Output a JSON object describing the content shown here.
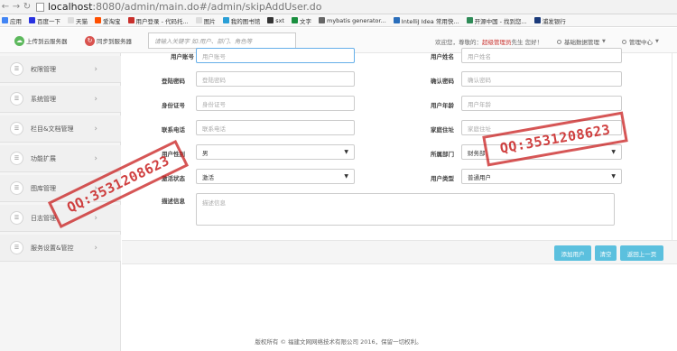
{
  "browser": {
    "url_host": "localhost",
    "url_path": ":8080/admin/main.do#/admin/skipAddUser.do",
    "bookmarks": [
      {
        "label": "应用",
        "color": "#4285f4"
      },
      {
        "label": "百度一下",
        "color": "#2932e1"
      },
      {
        "label": "天猫",
        "color": "#dddddd"
      },
      {
        "label": "爱淘宝",
        "color": "#ff5000"
      },
      {
        "label": "用户登录 - 代码托...",
        "color": "#c9302c"
      },
      {
        "label": "图片",
        "color": "#dddddd"
      },
      {
        "label": "我的图书馆",
        "color": "#2a9fd6"
      },
      {
        "label": "sxt",
        "color": "#333333"
      },
      {
        "label": "文字",
        "color": "#1a8f3f"
      },
      {
        "label": "mybatis generator...",
        "color": "#666666"
      },
      {
        "label": "IntelliJ Idea 常用快...",
        "color": "#2a6ebb"
      },
      {
        "label": "开源中国 - 找到您...",
        "color": "#2e8b57"
      },
      {
        "label": "浦发银行",
        "color": "#1b3a7a"
      }
    ]
  },
  "header": {
    "upload_label": "上传到云服务器",
    "sync_label": "同步到服务器",
    "search_placeholder": "请输入关键字 如:用户、部门、角色等",
    "welcome_prefix": "欢迎您，尊敬的：",
    "welcome_role": "超级管理员",
    "welcome_suffix": "先生 您好！",
    "menu_basic": "基础数据管理",
    "menu_admin": "管理中心"
  },
  "sidebar": {
    "items": [
      {
        "label": "权限管理"
      },
      {
        "label": "系统管理"
      },
      {
        "label": "栏目&文档管理"
      },
      {
        "label": "功能扩展"
      },
      {
        "label": "图库管理"
      },
      {
        "label": "日志管理"
      },
      {
        "label": "服务设置&管控"
      }
    ]
  },
  "form": {
    "row0": {
      "left_label": "用户账号",
      "left_placeholder": "用户账号",
      "right_label": "用户姓名",
      "right_placeholder": "用户姓名"
    },
    "row1": {
      "left_label": "登陆密码",
      "left_placeholder": "登陆密码",
      "right_label": "确认密码",
      "right_placeholder": "确认密码"
    },
    "row2": {
      "left_label": "身份证号",
      "left_placeholder": "身份证号",
      "right_label": "用户年龄",
      "right_placeholder": "用户年龄"
    },
    "row3": {
      "left_label": "联系电话",
      "left_placeholder": "联系电话",
      "right_label": "家庭住址",
      "right_placeholder": "家庭住址"
    },
    "row4": {
      "left_label": "用户性别",
      "left_value": "男",
      "right_label": "所属部门",
      "right_value": "财务部"
    },
    "row5": {
      "left_label": "激活状态",
      "left_value": "激活",
      "right_label": "用户类型",
      "right_value": "普通用户"
    },
    "desc_label": "描述信息",
    "desc_placeholder": "描述信息"
  },
  "buttons": {
    "add": "添加用户",
    "clear": "清空",
    "back": "返回上一页"
  },
  "footer": {
    "copyright": "版权所有 © 福建文网网络技术有限公司 2016，保留一切权利。"
  },
  "watermark": {
    "text": "QQ:3531208623"
  }
}
